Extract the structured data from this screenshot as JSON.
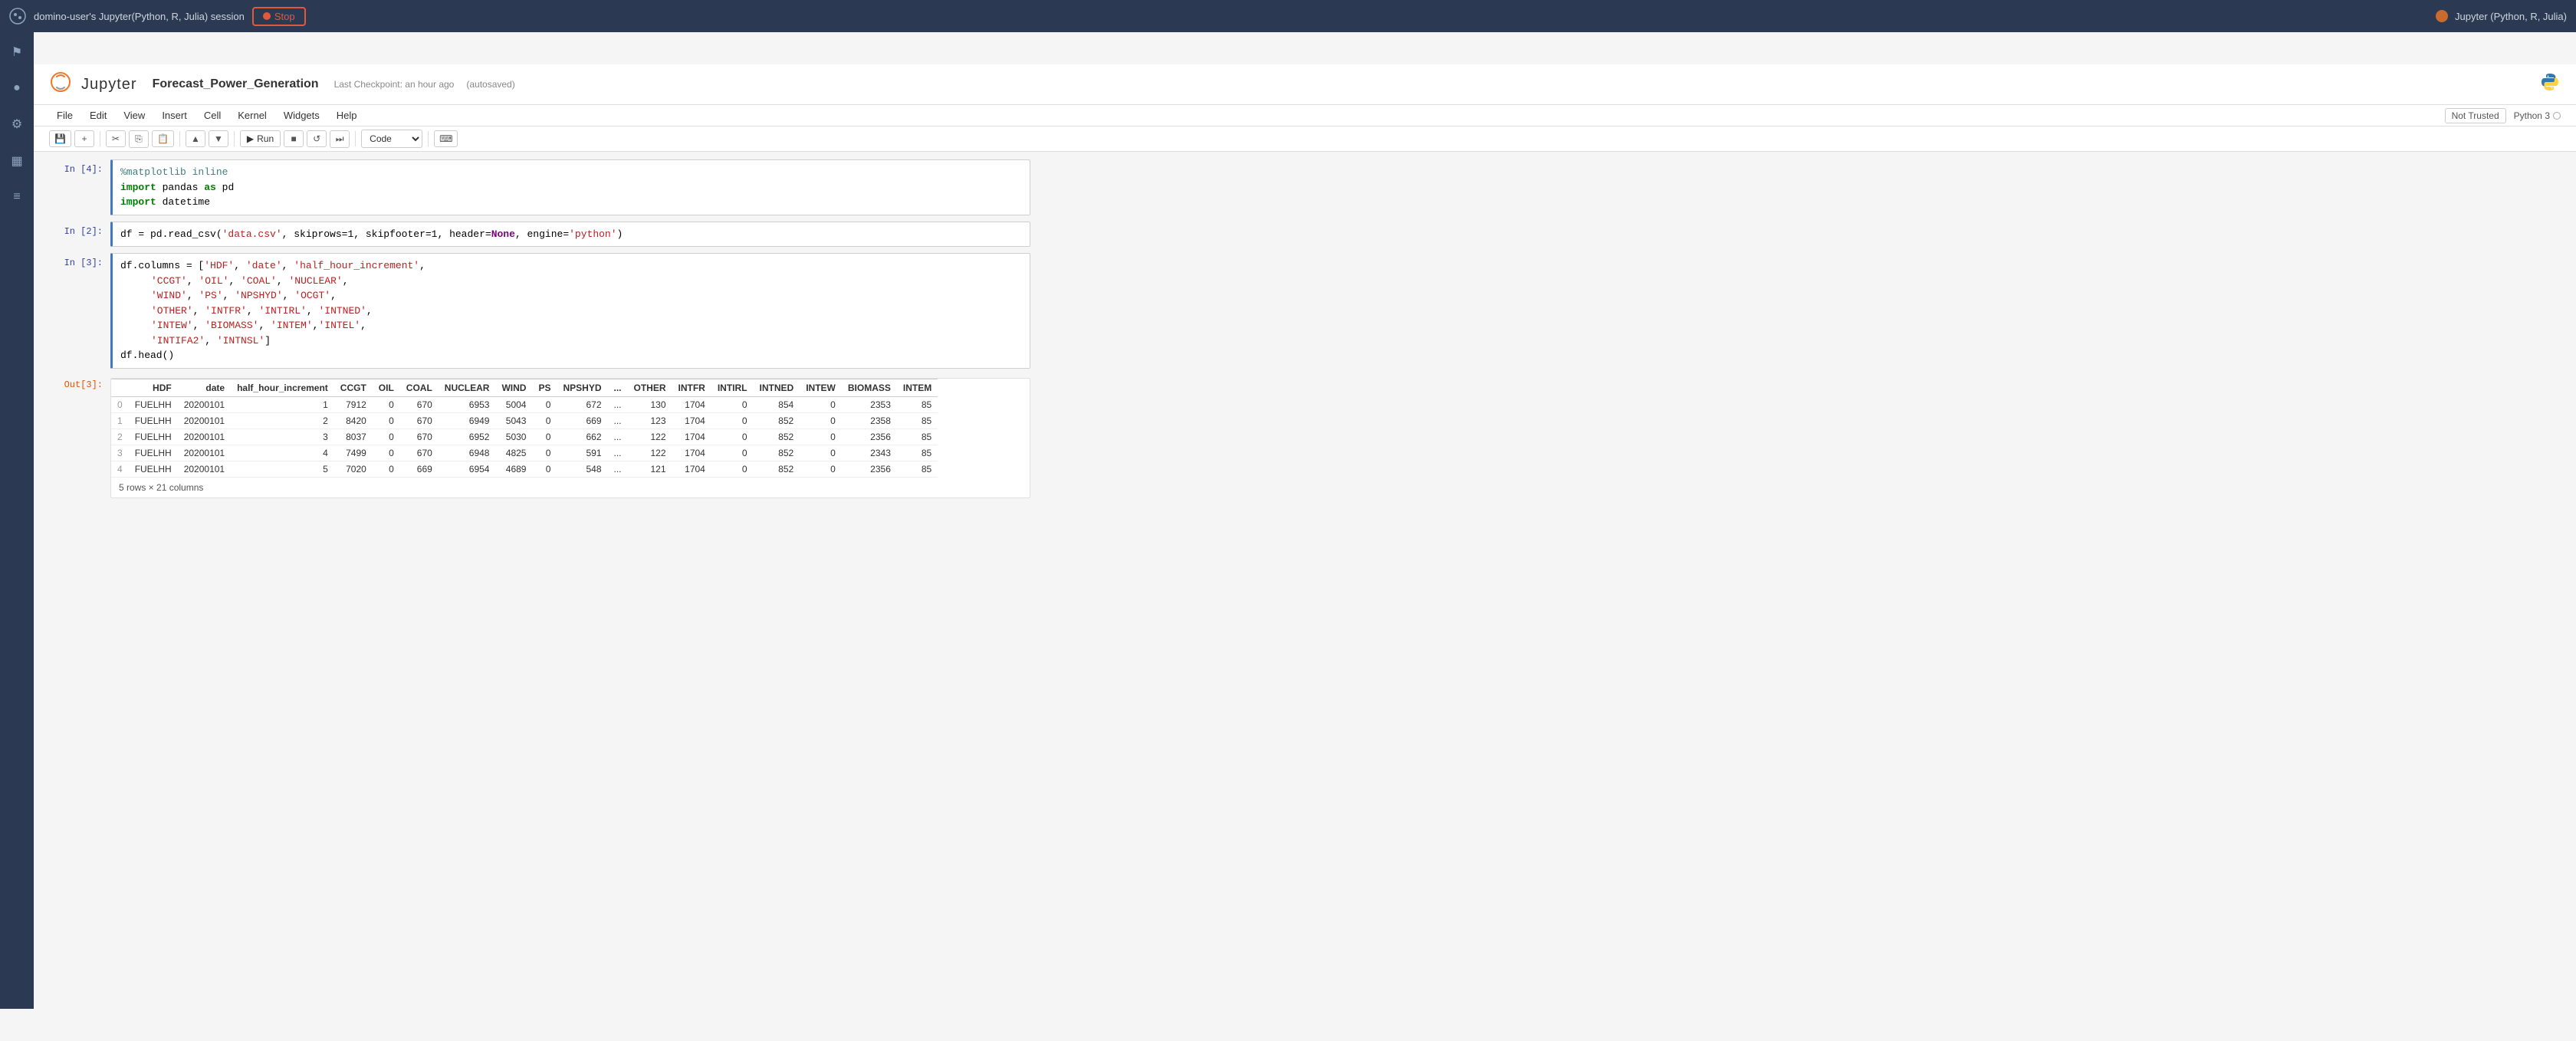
{
  "topbar": {
    "title": "domino-user's Jupyter(Python, R, Julia) session",
    "stop_label": "Stop",
    "session_label": "Jupyter (Python, R, Julia)"
  },
  "header": {
    "notebook_title": "Forecast_Power_Generation",
    "checkpoint": "Last Checkpoint: an hour ago",
    "autosaved": "(autosaved)"
  },
  "menubar": {
    "items": [
      "File",
      "Edit",
      "View",
      "Insert",
      "Cell",
      "Kernel",
      "Widgets",
      "Help"
    ],
    "trusted_label": "Not Trusted",
    "kernel_label": "Python 3"
  },
  "toolbar": {
    "run_label": "Run",
    "cell_type": "Code"
  },
  "cells": {
    "in4_prompt": "In [4]:",
    "in2_prompt": "In [2]:",
    "in3_prompt": "In [3]:",
    "out3_prompt": "Out[3]:"
  },
  "code": {
    "cell4_line1": "%matplotlib inline",
    "cell4_line2_kw": "import",
    "cell4_line2_mod": "pandas",
    "cell4_line2_as": "as",
    "cell4_line2_alias": "pd",
    "cell4_line3_kw": "import",
    "cell4_line3_mod": "datetime",
    "cell2": "df = pd.read_csv('data.csv', skiprows=1, skipfooter=1, header=None, engine='python')",
    "cell3_line1": "df.columns = ['HDF', 'date', 'half_hour_increment',",
    "cell3_line2": "              'CCGT', 'OIL', 'COAL', 'NUCLEAR',",
    "cell3_line3": "              'WIND', 'PS', 'NPSHYD', 'OCGT',",
    "cell3_line4": "              'OTHER', 'INTFR', 'INTIRL', 'INTNED',",
    "cell3_line5": "              'INTEW', 'BIOMASS', 'INTEM','INTEL',",
    "cell3_line6": "              'INTIFA2', 'INTNSL']",
    "cell3_line7": "df.head()"
  },
  "table": {
    "columns": [
      "",
      "HDF",
      "date",
      "half_hour_increment",
      "CCGT",
      "OIL",
      "COAL",
      "NUCLEAR",
      "WIND",
      "PS",
      "NPSHYD",
      "...",
      "OTHER",
      "INTFR",
      "INTIRL",
      "INTNED",
      "INTEW",
      "BIOMASS",
      "INTEM"
    ],
    "rows": [
      [
        "0",
        "FUELHH",
        "20200101",
        "1",
        "7912",
        "0",
        "670",
        "6953",
        "5004",
        "0",
        "672",
        "...",
        "130",
        "1704",
        "0",
        "854",
        "0",
        "2353",
        "85"
      ],
      [
        "1",
        "FUELHH",
        "20200101",
        "2",
        "8420",
        "0",
        "670",
        "6949",
        "5043",
        "0",
        "669",
        "...",
        "123",
        "1704",
        "0",
        "852",
        "0",
        "2358",
        "85"
      ],
      [
        "2",
        "FUELHH",
        "20200101",
        "3",
        "8037",
        "0",
        "670",
        "6952",
        "5030",
        "0",
        "662",
        "...",
        "122",
        "1704",
        "0",
        "852",
        "0",
        "2356",
        "85"
      ],
      [
        "3",
        "FUELHH",
        "20200101",
        "4",
        "7499",
        "0",
        "670",
        "6948",
        "4825",
        "0",
        "591",
        "...",
        "122",
        "1704",
        "0",
        "852",
        "0",
        "2343",
        "85"
      ],
      [
        "4",
        "FUELHH",
        "20200101",
        "5",
        "7020",
        "0",
        "669",
        "6954",
        "4689",
        "0",
        "548",
        "...",
        "121",
        "1704",
        "0",
        "852",
        "0",
        "2356",
        "85"
      ]
    ],
    "footer": "5 rows × 21 columns"
  }
}
